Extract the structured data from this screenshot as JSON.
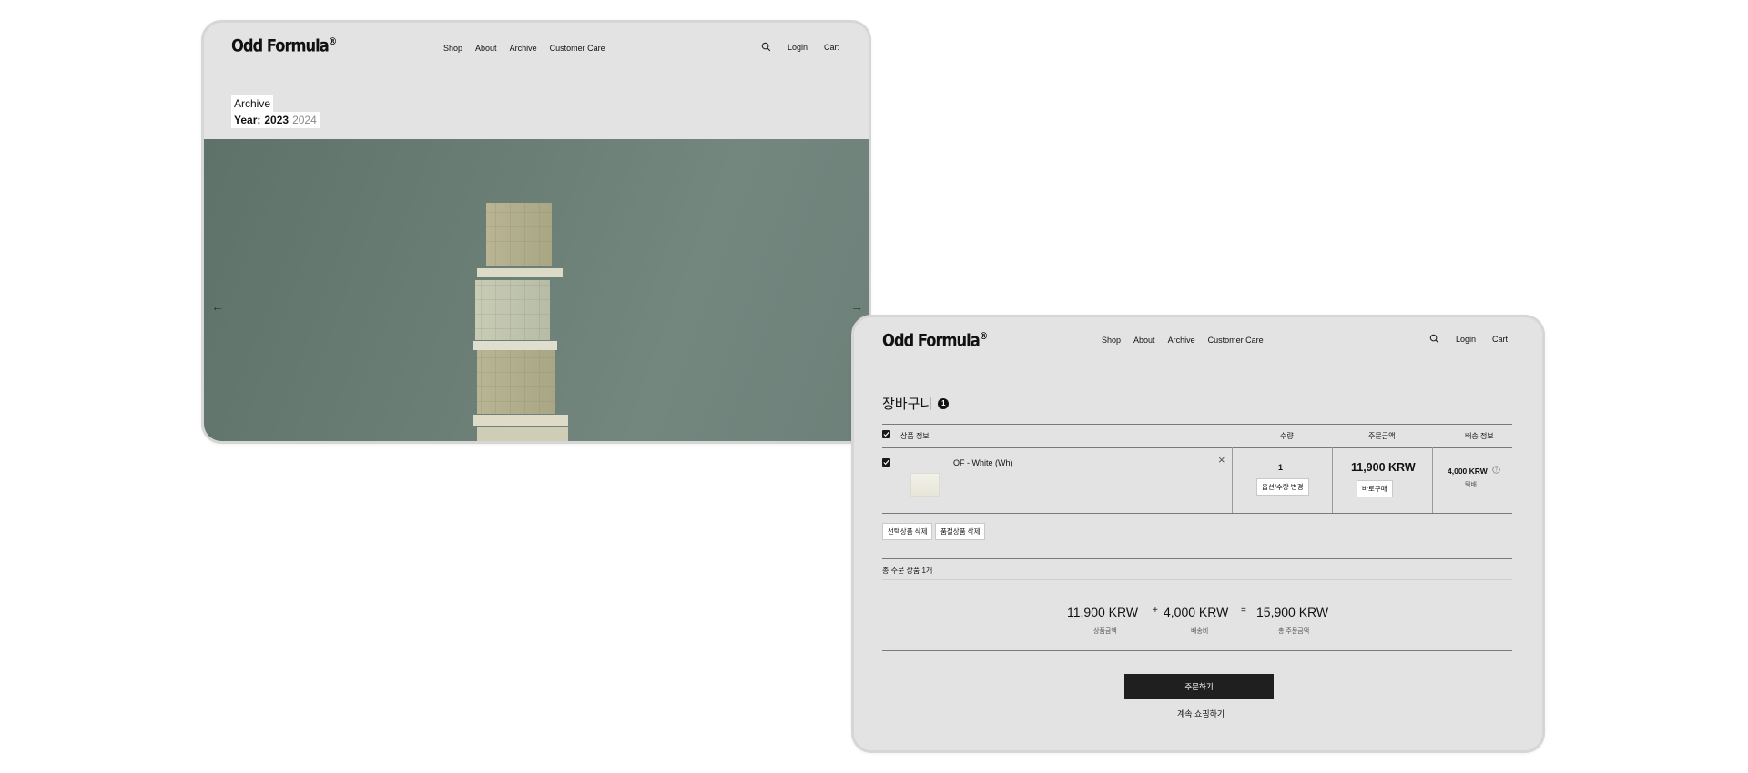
{
  "brand": {
    "logo": "Odd Formula",
    "mark": "®"
  },
  "nav": {
    "links": [
      "Shop",
      "About",
      "Archive",
      "Customer Care"
    ],
    "login": "Login",
    "cart": "Cart"
  },
  "archive_page": {
    "title": "Archive",
    "year_label": "Year:",
    "years": [
      "2023",
      "2024"
    ],
    "active_year": "2023",
    "prev_arrow": "←",
    "next_arrow": "→"
  },
  "cart_page": {
    "title": "장바구니",
    "count": "1",
    "headers": {
      "product": "상품 정보",
      "qty": "수량",
      "price": "주문금액",
      "shipping": "배송 정보"
    },
    "item": {
      "name": "OF - White (Wh)",
      "quantity": "1",
      "change_option": "옵션/수량 변경",
      "price": "11,900 KRW",
      "buy_now": "바로구매",
      "shipping_fee": "4,000 KRW",
      "shipping_method": "택배",
      "remove": "×"
    },
    "delete_selected": "선택상품 삭제",
    "delete_soldout": "품절상품 삭제",
    "total_items": "총 주문 상품 1개",
    "summary": {
      "subtotal": "11,900 KRW",
      "subtotal_label": "상품금액",
      "plus": "+",
      "shipping": "4,000 KRW",
      "shipping_label": "배송비",
      "equals": "=",
      "total": "15,900 KRW",
      "total_label": "총 주문금액"
    },
    "order_button": "주문하기",
    "continue_shopping": "계속 쇼핑하기"
  }
}
